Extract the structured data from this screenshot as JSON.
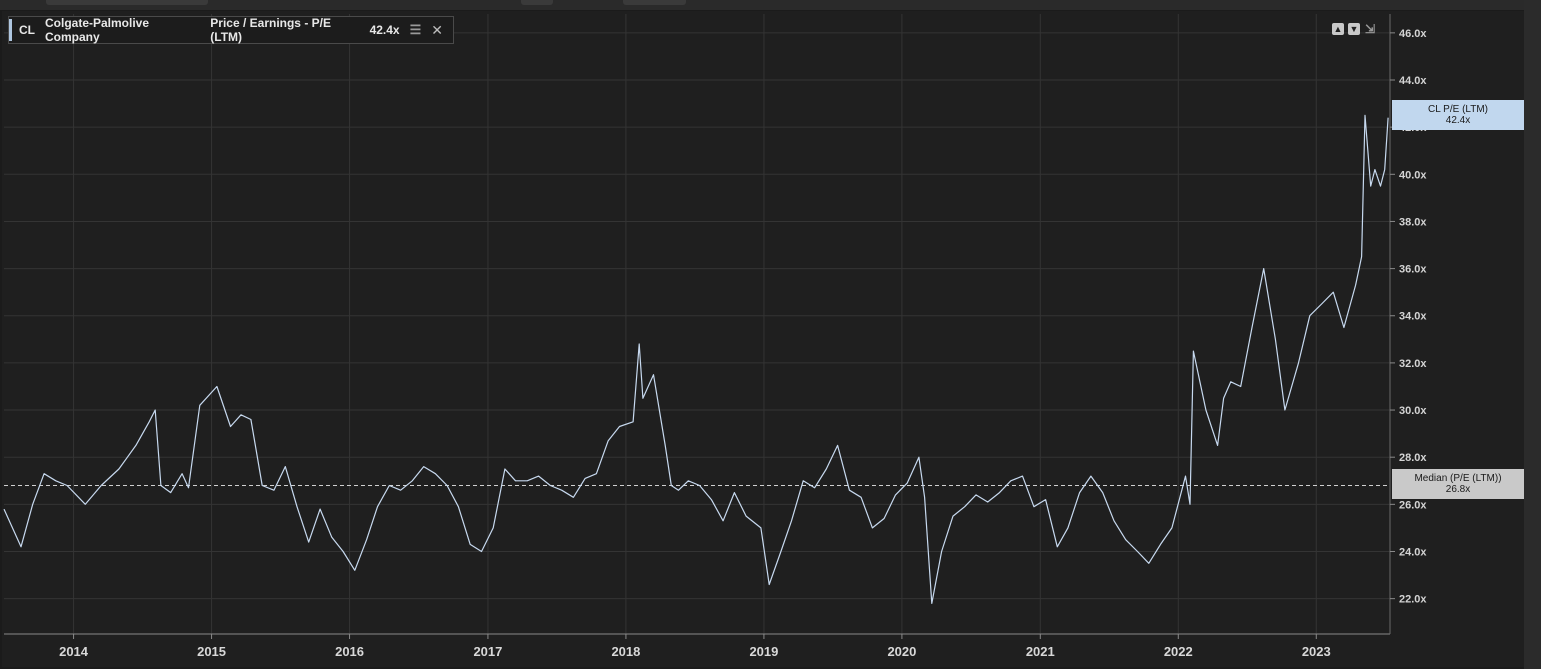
{
  "legend": {
    "ticker": "CL",
    "company": "Colgate-Palmolive Company",
    "metric": "Price / Earnings - P/E (LTM)",
    "value": "42.4x"
  },
  "flags": {
    "last_label": "CL P/E (LTM)",
    "last_value": "42.4x",
    "median_label": "Median (P/E (LTM))",
    "median_value": "26.8x"
  },
  "colors": {
    "series": "#c7d9ef",
    "background": "#1f1f1f",
    "grid": "#343434",
    "median_line": "#d0d0d0"
  },
  "chart_data": {
    "type": "line",
    "title": "",
    "xlabel": "",
    "ylabel": "",
    "x_tick_labels": [
      "2014",
      "2015",
      "2016",
      "2017",
      "2018",
      "2019",
      "2020",
      "2021",
      "2022",
      "2023"
    ],
    "y_tick_labels": [
      "22.0x",
      "24.0x",
      "26.0x",
      "28.0x",
      "30.0x",
      "32.0x",
      "34.0x",
      "36.0x",
      "38.0x",
      "40.0x",
      "42.0x",
      "44.0x",
      "46.0x"
    ],
    "ylim": [
      20.5,
      46.8
    ],
    "xlim": [
      "2013-07-01",
      "2023-07-15"
    ],
    "median": 26.8,
    "last": 42.4,
    "grid": true,
    "series": [
      {
        "name": "CL P/E (LTM)",
        "x": [
          "2013-07-01",
          "2013-08-15",
          "2013-09-15",
          "2013-10-15",
          "2013-11-15",
          "2013-12-15",
          "2014-02-01",
          "2014-03-15",
          "2014-05-01",
          "2014-06-15",
          "2014-07-20",
          "2014-08-05",
          "2014-08-20",
          "2014-09-15",
          "2014-10-15",
          "2014-11-01",
          "2014-12-01",
          "2015-01-15",
          "2015-02-20",
          "2015-03-20",
          "2015-04-15",
          "2015-05-15",
          "2015-06-15",
          "2015-07-15",
          "2015-08-15",
          "2015-09-15",
          "2015-10-15",
          "2015-11-15",
          "2015-12-15",
          "2016-01-15",
          "2016-02-15",
          "2016-03-15",
          "2016-04-15",
          "2016-05-15",
          "2016-06-15",
          "2016-07-15",
          "2016-08-15",
          "2016-09-15",
          "2016-10-15",
          "2016-11-15",
          "2016-12-15",
          "2017-01-15",
          "2017-02-15",
          "2017-03-15",
          "2017-04-15",
          "2017-05-15",
          "2017-06-15",
          "2017-07-15",
          "2017-08-15",
          "2017-09-15",
          "2017-10-15",
          "2017-11-15",
          "2017-12-15",
          "2018-01-20",
          "2018-02-05",
          "2018-02-15",
          "2018-03-15",
          "2018-04-15",
          "2018-05-01",
          "2018-05-20",
          "2018-06-15",
          "2018-07-15",
          "2018-08-15",
          "2018-09-15",
          "2018-10-15",
          "2018-11-15",
          "2018-12-24",
          "2019-01-15",
          "2019-02-15",
          "2019-03-15",
          "2019-04-15",
          "2019-05-15",
          "2019-06-15",
          "2019-07-15",
          "2019-08-15",
          "2019-09-15",
          "2019-10-15",
          "2019-11-15",
          "2019-12-15",
          "2020-01-15",
          "2020-02-15",
          "2020-03-01",
          "2020-03-20",
          "2020-04-15",
          "2020-05-15",
          "2020-06-15",
          "2020-07-15",
          "2020-08-15",
          "2020-09-15",
          "2020-10-15",
          "2020-11-15",
          "2020-12-15",
          "2021-01-15",
          "2021-02-15",
          "2021-03-15",
          "2021-04-15",
          "2021-05-15",
          "2021-06-15",
          "2021-07-15",
          "2021-08-15",
          "2021-09-15",
          "2021-10-15",
          "2021-11-15",
          "2021-12-15",
          "2022-01-20",
          "2022-02-01",
          "2022-02-10",
          "2022-03-15",
          "2022-04-15",
          "2022-05-01",
          "2022-05-20",
          "2022-06-15",
          "2022-07-15",
          "2022-08-15",
          "2022-09-15",
          "2022-10-10",
          "2022-11-15",
          "2022-12-15",
          "2023-01-15",
          "2023-02-15",
          "2023-03-15",
          "2023-04-15",
          "2023-05-01",
          "2023-05-10",
          "2023-05-25",
          "2023-06-05",
          "2023-06-20",
          "2023-07-01",
          "2023-07-10"
        ],
        "values": [
          25.8,
          24.2,
          26.0,
          27.3,
          27.0,
          26.8,
          26.0,
          26.8,
          27.5,
          28.5,
          29.5,
          30.0,
          26.8,
          26.5,
          27.3,
          26.7,
          30.2,
          31.0,
          29.3,
          29.8,
          29.6,
          26.8,
          26.6,
          27.6,
          25.9,
          24.4,
          25.8,
          24.6,
          24.0,
          23.2,
          24.5,
          25.9,
          26.8,
          26.6,
          27.0,
          27.6,
          27.3,
          26.8,
          25.9,
          24.3,
          24.0,
          25.0,
          27.5,
          27.0,
          27.0,
          27.2,
          26.8,
          26.6,
          26.3,
          27.1,
          27.3,
          28.7,
          29.3,
          29.5,
          32.8,
          30.5,
          31.5,
          28.5,
          26.8,
          26.6,
          27.0,
          26.8,
          26.2,
          25.3,
          26.5,
          25.5,
          25.0,
          22.6,
          24.0,
          25.3,
          27.0,
          26.7,
          27.5,
          28.5,
          26.6,
          26.3,
          25.0,
          25.4,
          26.4,
          26.9,
          28.0,
          26.3,
          21.8,
          24.0,
          25.5,
          25.9,
          26.4,
          26.1,
          26.5,
          27.0,
          27.2,
          25.9,
          26.2,
          24.2,
          25.0,
          26.5,
          27.2,
          26.5,
          25.3,
          24.5,
          24.0,
          23.5,
          24.3,
          25.0,
          27.2,
          26.0,
          32.5,
          30.0,
          28.5,
          30.5,
          31.2,
          31.0,
          33.5,
          36.0,
          33.0,
          30.0,
          32.0,
          34.0,
          34.5,
          35.0,
          33.5,
          35.3,
          36.5,
          42.5,
          39.5,
          40.2,
          39.5,
          40.2,
          42.4
        ]
      }
    ]
  }
}
